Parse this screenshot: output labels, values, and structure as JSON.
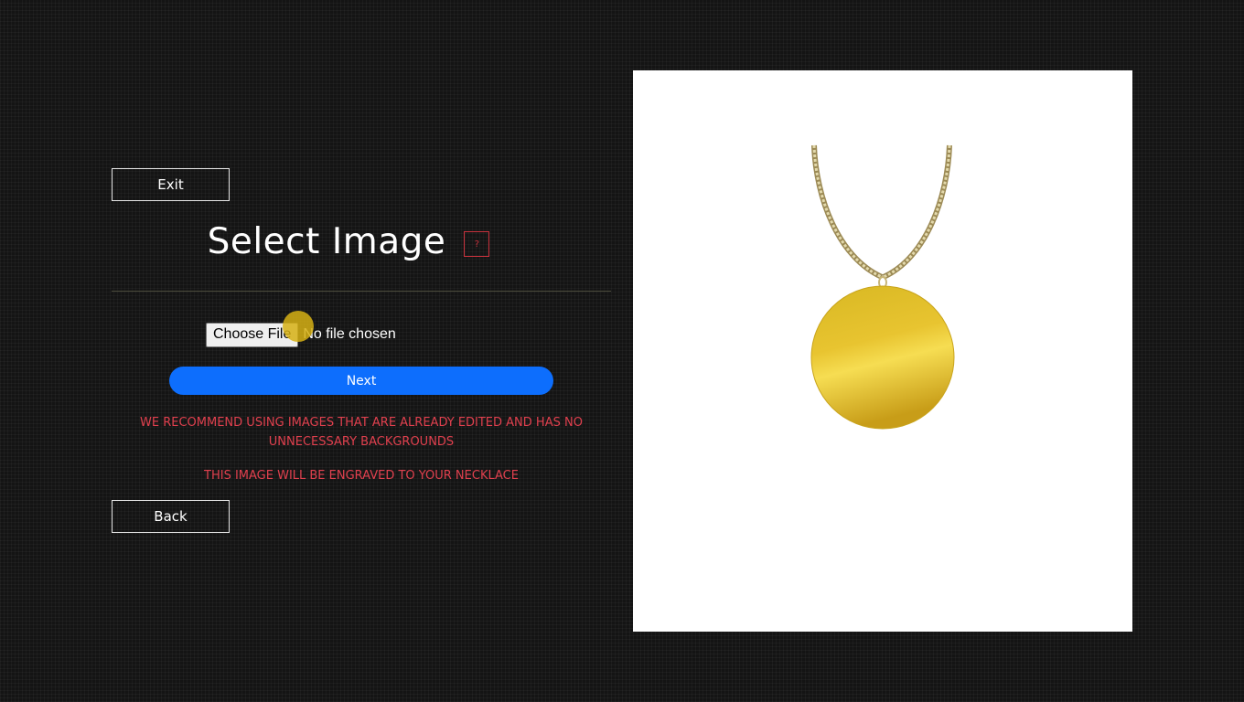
{
  "actions": {
    "exit_label": "Exit",
    "back_label": "Back",
    "next_label": "Next"
  },
  "header": {
    "title": "Select Image",
    "help_label": "?"
  },
  "file_input": {
    "button_label": "Choose File",
    "status": "No file chosen"
  },
  "notes": {
    "recommendation": "WE RECOMMEND USING IMAGES THAT ARE ALREADY EDITED AND HAS NO UNNECESSARY BACKGROUNDS",
    "engrave": "THIS IMAGE WILL BE ENGRAVED TO YOUR NECKLACE"
  },
  "colors": {
    "background": "#141414",
    "accent_blue": "#0d6efd",
    "warning_red": "#e0404e",
    "pendant_gold": "#e8c430"
  },
  "preview": {
    "icon": "gold-pendant-necklace"
  }
}
